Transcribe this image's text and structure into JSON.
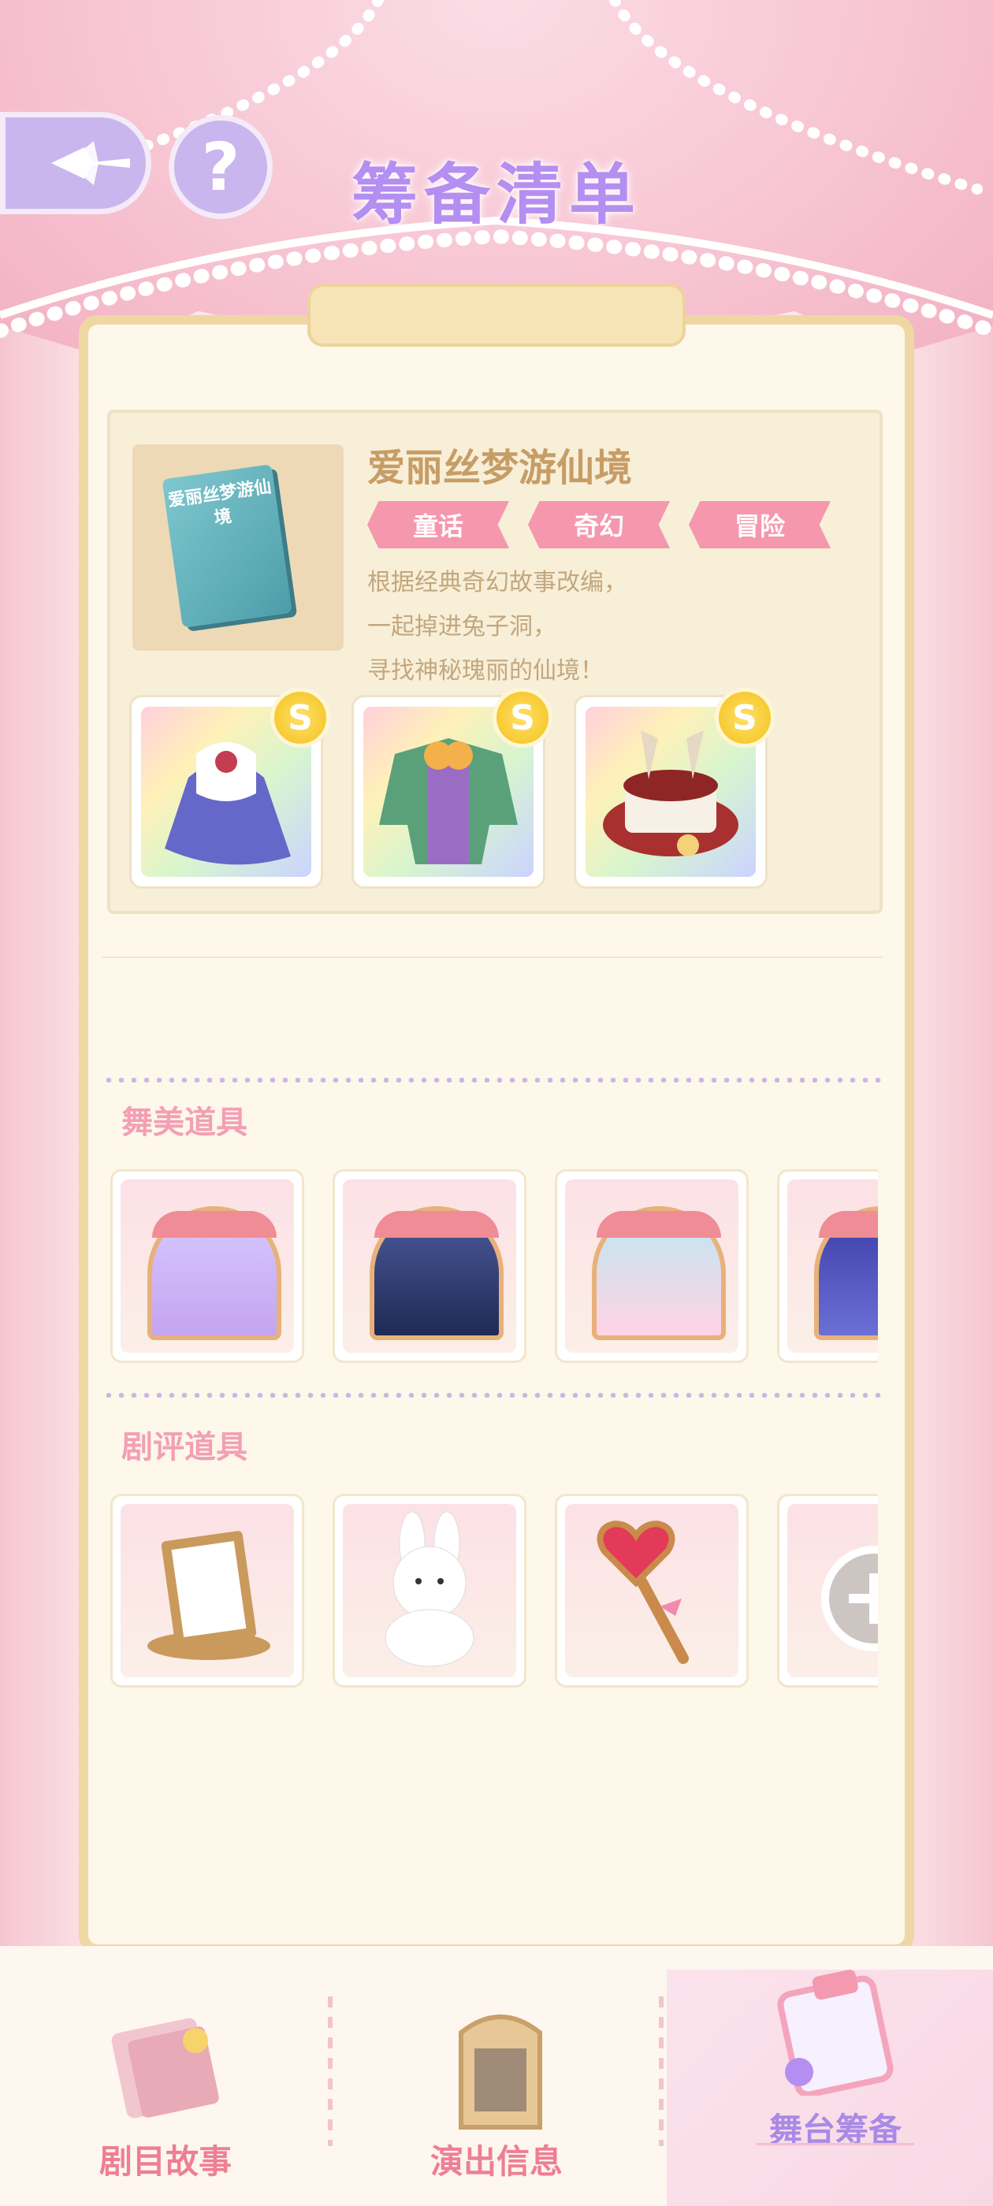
{
  "header": {
    "title": "筹备清单",
    "help_glyph": "?",
    "back_icon": "sparkle-back-icon"
  },
  "story": {
    "cover_text": "爱丽丝梦游仙境",
    "title": "爱丽丝梦游仙境",
    "tags": [
      "童话",
      "奇幻",
      "冒险"
    ],
    "description": "根据经典奇幻故事改编，\n一起掉进兔子洞，\n寻找神秘瑰丽的仙境！",
    "coin_glyph": "S",
    "items": [
      "dress-icon",
      "suit-icon",
      "rabbit-hat-icon"
    ]
  },
  "sections": {
    "stage_props": {
      "label": "舞美道具",
      "items": [
        "stage-lilac",
        "stage-night",
        "stage-heart",
        "stage-stars"
      ]
    },
    "review_props": {
      "label": "剧评道具",
      "items": [
        "card-frame-icon",
        "rabbit-plush-icon",
        "heart-wand-icon",
        "add-icon"
      ]
    }
  },
  "nav": [
    {
      "label": "剧目故事",
      "icon": "story-book-icon",
      "active": false
    },
    {
      "label": "演出信息",
      "icon": "info-board-icon",
      "active": false
    },
    {
      "label": "舞台筹备",
      "icon": "clipboard-icon",
      "active": true
    }
  ],
  "colors": {
    "accent_purple": "#b48ef0",
    "tag_pink": "#f597ad",
    "label_pink": "#f39fb4",
    "nav_pink": "#ee7f93",
    "active_purple": "#a98ae6"
  }
}
